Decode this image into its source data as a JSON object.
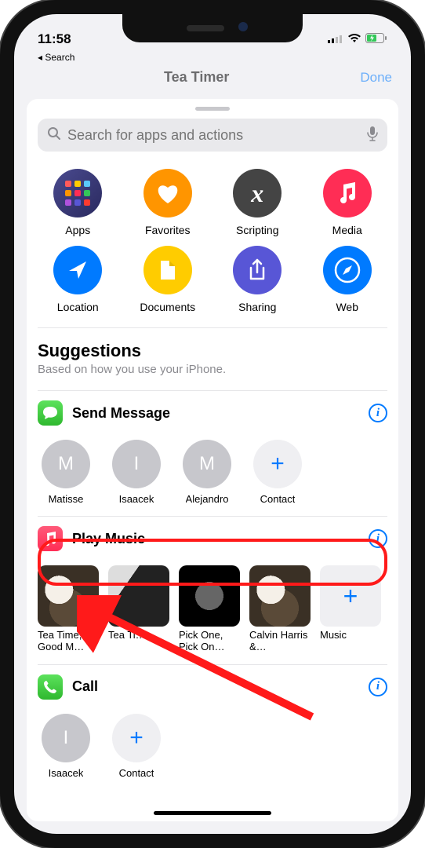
{
  "status": {
    "time": "11:58",
    "back": "Search"
  },
  "header": {
    "title": "Tea Timer",
    "done": "Done"
  },
  "search": {
    "placeholder": "Search for apps and actions"
  },
  "categories": [
    {
      "name": "Apps"
    },
    {
      "name": "Favorites"
    },
    {
      "name": "Scripting"
    },
    {
      "name": "Media"
    },
    {
      "name": "Location"
    },
    {
      "name": "Documents"
    },
    {
      "name": "Sharing"
    },
    {
      "name": "Web"
    }
  ],
  "suggestions": {
    "heading": "Suggestions",
    "sub": "Based on how you use your iPhone."
  },
  "send_message": {
    "label": "Send Message",
    "contacts": [
      {
        "initial": "M",
        "name": "Matisse"
      },
      {
        "initial": "I",
        "name": "Isaacek"
      },
      {
        "initial": "M",
        "name": "Alejandro"
      }
    ],
    "add": "Contact"
  },
  "play_music": {
    "label": "Play Music",
    "albums": [
      {
        "title": "Tea Time, Good M…"
      },
      {
        "title": "Tea Ti…"
      },
      {
        "title": "Pick One, Pick On…"
      },
      {
        "title": "Calvin Harris &…"
      }
    ],
    "add": "Music"
  },
  "call": {
    "label": "Call",
    "contacts": [
      {
        "initial": "I",
        "name": "Isaacek"
      }
    ],
    "add": "Contact"
  }
}
